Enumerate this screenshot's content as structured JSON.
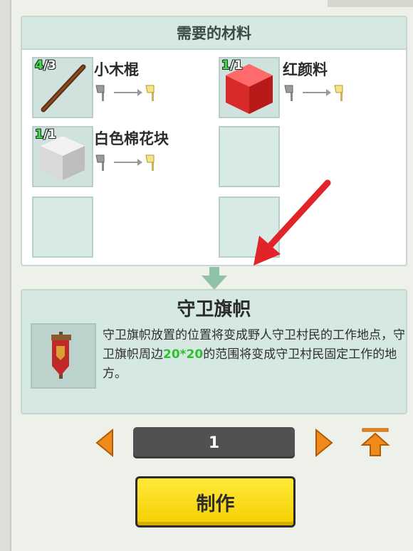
{
  "materials_header": "需要的材料",
  "materials": [
    {
      "name": "小木棍",
      "have": "4",
      "need": "/3",
      "icon": "wooden-stick-icon"
    },
    {
      "name": "红颜料",
      "have": "1",
      "need": "/1",
      "icon": "red-dye-cube-icon"
    },
    {
      "name": "白色棉花块",
      "have": "1",
      "need": "/1",
      "icon": "white-cotton-block-icon"
    }
  ],
  "result": {
    "title": "守卫旗帜",
    "desc_before": "守卫旗帜放置的位置将变成野人守卫村民的工作地点，守卫旗帜周边",
    "desc_highlight": "20*20",
    "desc_after": "的范围将变成守卫村民固定工作的地方。",
    "icon": "guard-banner-icon"
  },
  "quantity": "1",
  "make_button": "制作",
  "colors": {
    "accent_green": "#3ee04a",
    "button_yellow": "#f4cf00",
    "arrow_orange": "#f08a1c",
    "annotation_red": "#e0242a"
  }
}
